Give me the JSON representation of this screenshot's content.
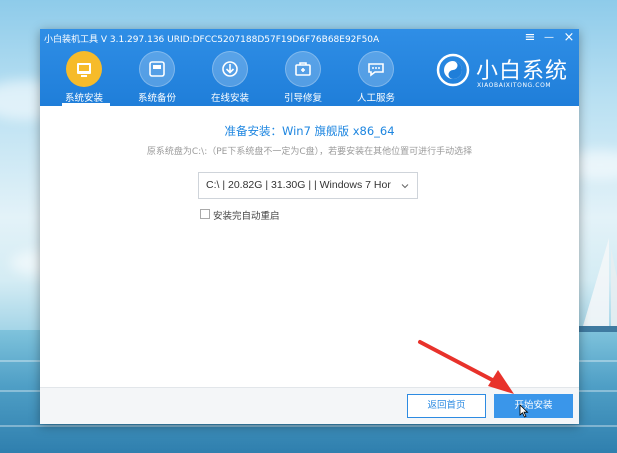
{
  "window": {
    "title": "小白装机工具 V 3.1.297.136 URID:DFCC5207188D57F19D6F76B68E92F50A",
    "controls": {
      "menu": "≡",
      "minimize": "—",
      "close": "×"
    }
  },
  "nav": {
    "items": [
      {
        "label": "系统安装",
        "icon": "system-install-icon",
        "active": true
      },
      {
        "label": "系统备份",
        "icon": "system-backup-icon",
        "active": false
      },
      {
        "label": "在线安装",
        "icon": "online-install-icon",
        "active": false
      },
      {
        "label": "引导修复",
        "icon": "boot-repair-icon",
        "active": false
      },
      {
        "label": "人工服务",
        "icon": "support-chat-icon",
        "active": false
      }
    ]
  },
  "brand": {
    "name": "小白系统",
    "subtitle": "XIAOBAIXITONG.COM",
    "logo_icon": "xiaobai-logo-icon"
  },
  "content": {
    "heading": "准备安装：Win7 旗舰版 x86_64",
    "subheading": "原系统盘为C:\\:（PE下系统盘不一定为C盘），若要安装在其他位置可进行手动选择",
    "partition_select": {
      "value": "C:\\ | 20.82G | 31.30G | | Windows 7 Hor"
    },
    "auto_restart": {
      "label": "安装完自动重启",
      "checked": false
    }
  },
  "footer": {
    "back_label": "返回首页",
    "start_label": "开始安装"
  },
  "colors": {
    "titlebar": "#1f7ed9",
    "accent": "#3a96ea",
    "active_nav": "#f6bb2a",
    "annotation_arrow": "#e8322b"
  }
}
